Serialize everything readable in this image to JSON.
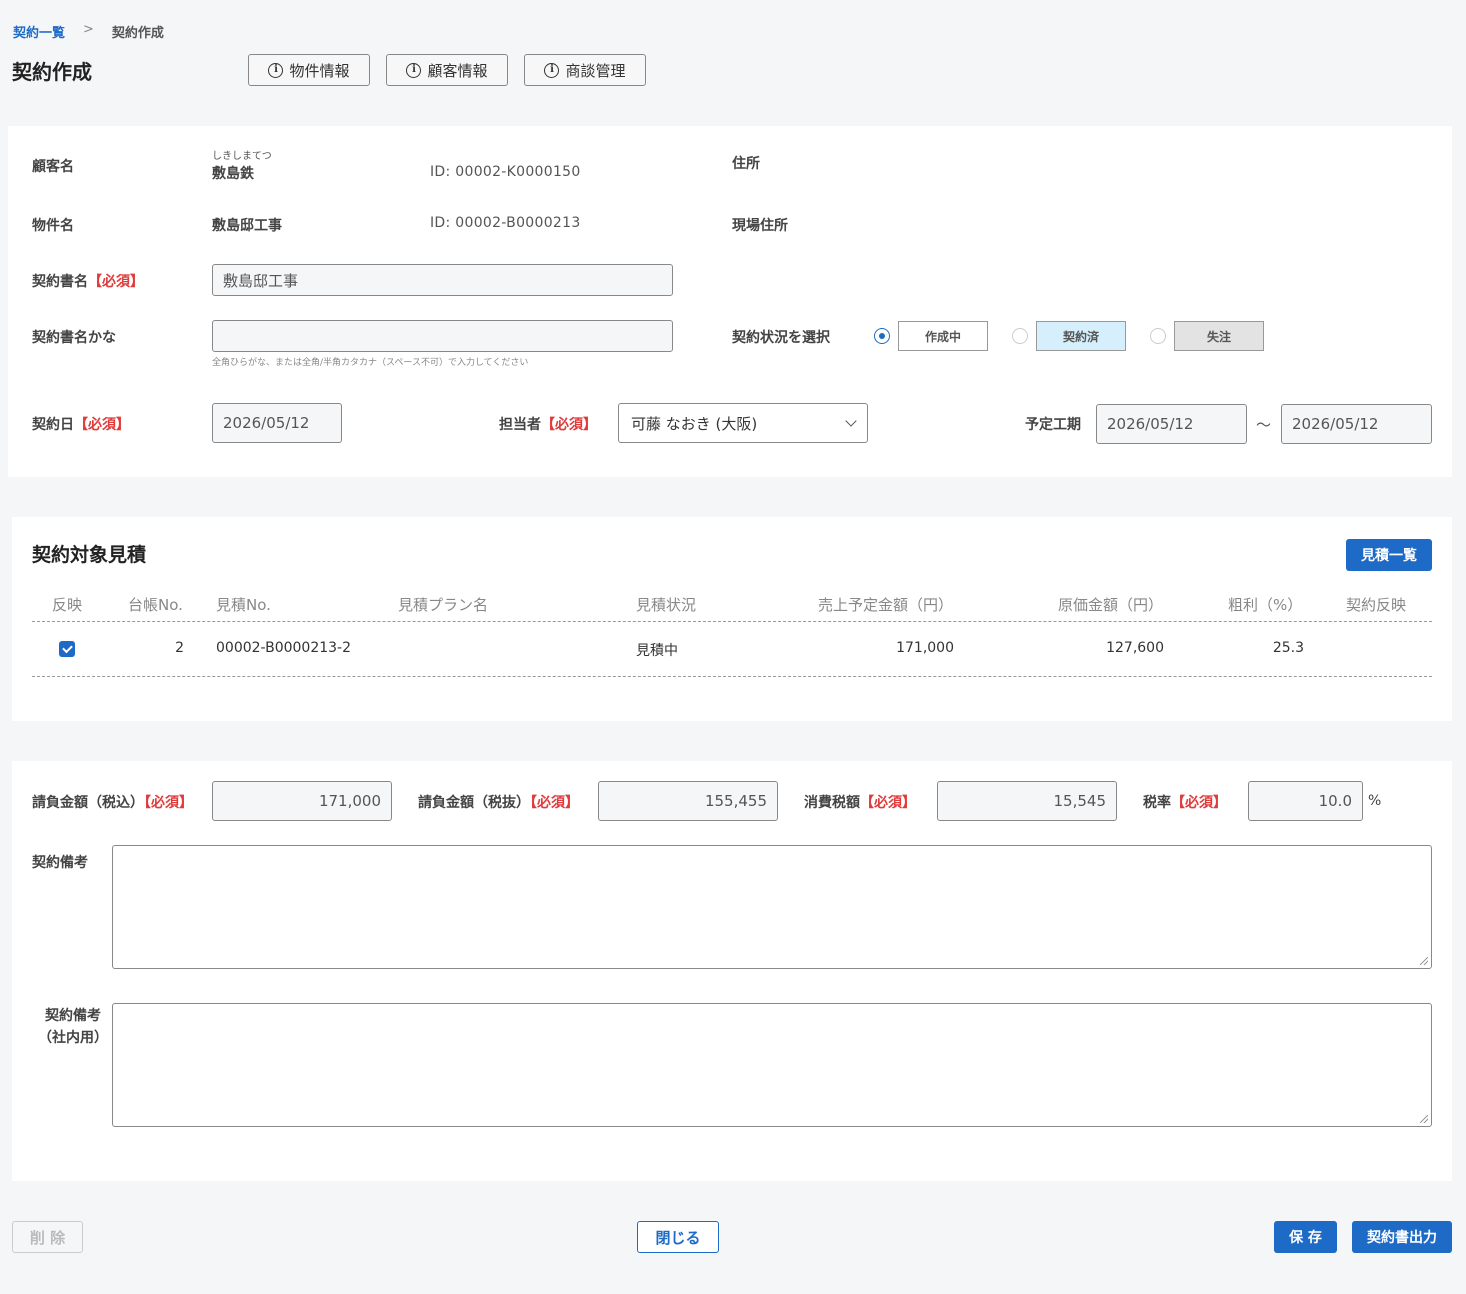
{
  "breadcrumb": {
    "link": "契約一覧",
    "sep": ">",
    "current": "契約作成"
  },
  "page_title": "契約作成",
  "header_buttons": {
    "property": "物件情報",
    "customer": "顧客情報",
    "deal": "商談管理",
    "icon": "i"
  },
  "customer": {
    "label": "顧客名",
    "ruby": "しきしまてつ",
    "name": "敷島鉄",
    "id": "ID: 00002-K0000150",
    "address_label": "住所"
  },
  "property": {
    "label": "物件名",
    "name": "敷島邸工事",
    "id": "ID: 00002-B0000213",
    "site_address_label": "現場住所"
  },
  "contract_name": {
    "label": "契約書名",
    "required": "【必須】",
    "value": "敷島邸工事"
  },
  "contract_kana": {
    "label": "契約書名かな",
    "value": "",
    "hint": "全角ひらがな、または全角/半角カタカナ（スペース不可）で入力してください"
  },
  "status": {
    "label": "契約状況を選択",
    "options": [
      {
        "label": "作成中",
        "color": "#ffffff"
      },
      {
        "label": "契約済",
        "color": "#d6effd"
      },
      {
        "label": "失注",
        "color": "#e3e3e3"
      }
    ]
  },
  "contract_date": {
    "label": "契約日",
    "required": "【必須】",
    "value": "2026/05/12"
  },
  "staff": {
    "label": "担当者",
    "required": "【必須】",
    "value": "可藤 なおき (大阪)"
  },
  "schedule": {
    "label": "予定工期",
    "from": "2026/05/12",
    "tilde": "～",
    "to": "2026/05/12"
  },
  "estimates": {
    "title": "契約対象見積",
    "list_button": "見積一覧",
    "columns": [
      "反映",
      "台帳No.",
      "見積No.",
      "見積プラン名",
      "見積状況",
      "売上予定金額（円）",
      "原価金額（円）",
      "粗利（%）",
      "契約反映"
    ],
    "rows": [
      {
        "ledger_no": "2",
        "estimate_no": "00002-B0000213-2",
        "plan_name": "",
        "status": "見積中",
        "sales": "171,000",
        "cost": "127,600",
        "margin": "25.3",
        "reflect": ""
      }
    ]
  },
  "amounts": {
    "required": "【必須】",
    "incl_tax": {
      "label": "請負金額（税込）",
      "value": "171,000"
    },
    "excl_tax": {
      "label": "請負金額（税抜）",
      "value": "155,455"
    },
    "tax": {
      "label": "消費税額",
      "value": "15,545"
    },
    "rate": {
      "label": "税率",
      "value": "10.0",
      "unit": "%"
    }
  },
  "remarks": {
    "label": "契約備考",
    "value": ""
  },
  "internal_remarks": {
    "label_1": "契約備考",
    "label_2": "（社内用）",
    "value": ""
  },
  "footer": {
    "delete": "削 除",
    "close": "閉じる",
    "save": "保 存",
    "export": "契約書出力"
  },
  "colors": {
    "accent": "#1e6bc7",
    "required": "#e03a3a"
  }
}
